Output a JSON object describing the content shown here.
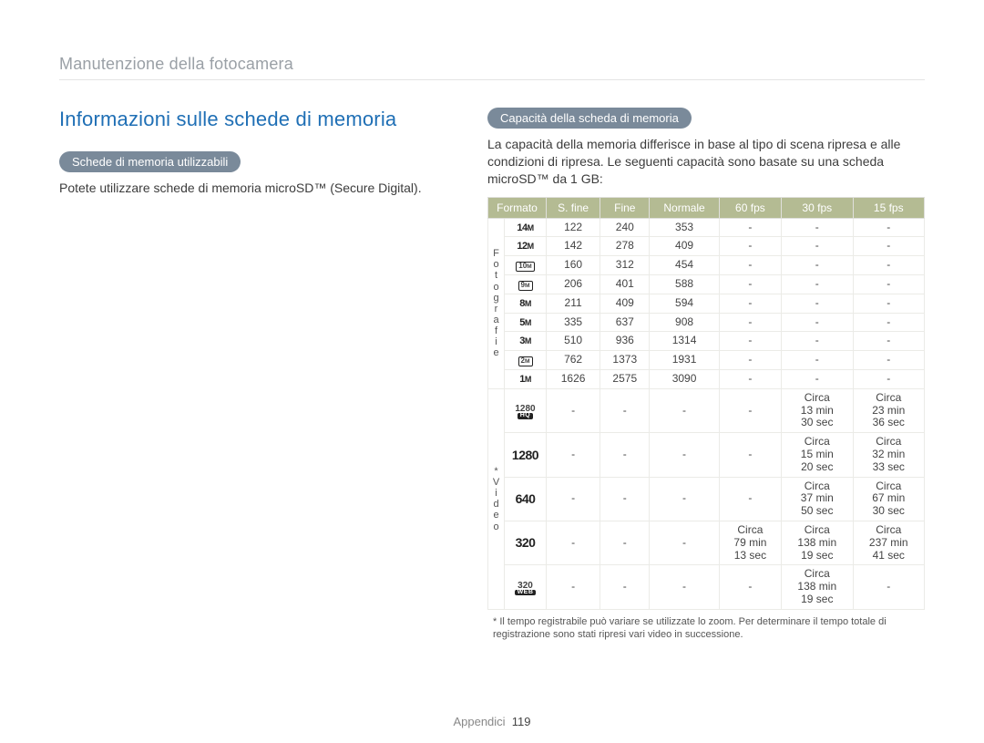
{
  "breadcrumb": "Manutenzione della fotocamera",
  "section_title": "Informazioni sulle schede di memoria",
  "left": {
    "pill": "Schede di memoria utilizzabili",
    "text": "Potete utilizzare schede di memoria microSD™ (Secure Digital)."
  },
  "right": {
    "pill": "Capacità della scheda di memoria",
    "text": "La capacità della memoria differisce in base al tipo di scena ripresa e alle condizioni di ripresa. Le seguenti capacità sono basate su una scheda microSD™ da 1 GB:"
  },
  "table": {
    "headers": [
      "Formato",
      "S. fine",
      "Fine",
      "Normale",
      "60 fps",
      "30 fps",
      "15 fps"
    ],
    "groups": [
      {
        "label": "F o t o g r a f i e",
        "rows": [
          {
            "fmt_label": "14M",
            "fmt_type": "bold",
            "cells": [
              "122",
              "240",
              "353",
              "-",
              "-",
              "-"
            ]
          },
          {
            "fmt_label": "12M",
            "fmt_type": "bold",
            "cells": [
              "142",
              "278",
              "409",
              "-",
              "-",
              "-"
            ]
          },
          {
            "fmt_label": "10M",
            "fmt_type": "box",
            "cells": [
              "160",
              "312",
              "454",
              "-",
              "-",
              "-"
            ]
          },
          {
            "fmt_label": "9M",
            "fmt_type": "box",
            "cells": [
              "206",
              "401",
              "588",
              "-",
              "-",
              "-"
            ]
          },
          {
            "fmt_label": "8M",
            "fmt_type": "bold",
            "cells": [
              "211",
              "409",
              "594",
              "-",
              "-",
              "-"
            ]
          },
          {
            "fmt_label": "5M",
            "fmt_type": "bold",
            "cells": [
              "335",
              "637",
              "908",
              "-",
              "-",
              "-"
            ]
          },
          {
            "fmt_label": "3M",
            "fmt_type": "bold",
            "cells": [
              "510",
              "936",
              "1314",
              "-",
              "-",
              "-"
            ]
          },
          {
            "fmt_label": "2M",
            "fmt_type": "box",
            "cells": [
              "762",
              "1373",
              "1931",
              "-",
              "-",
              "-"
            ]
          },
          {
            "fmt_label": "1M",
            "fmt_type": "bold",
            "cells": [
              "1626",
              "2575",
              "3090",
              "-",
              "-",
              "-"
            ]
          }
        ]
      },
      {
        "label": "* V i d e o",
        "rows": [
          {
            "fmt_label": "1280",
            "fmt_sub": "HQ",
            "fmt_type": "stack",
            "cells": [
              "-",
              "-",
              "-",
              "-",
              "Circa\n13 min\n30 sec",
              "Circa\n23 min\n36 sec"
            ]
          },
          {
            "fmt_label": "1280",
            "fmt_type": "bold-lg",
            "cells": [
              "-",
              "-",
              "-",
              "-",
              "Circa\n15 min\n20 sec",
              "Circa\n32 min\n33 sec"
            ]
          },
          {
            "fmt_label": "640",
            "fmt_type": "bold-lg",
            "cells": [
              "-",
              "-",
              "-",
              "-",
              "Circa\n37 min\n50 sec",
              "Circa\n67 min\n30 sec"
            ]
          },
          {
            "fmt_label": "320",
            "fmt_type": "bold-lg",
            "cells": [
              "-",
              "-",
              "-",
              "Circa\n79 min\n13 sec",
              "Circa\n138 min\n19 sec",
              "Circa\n237 min\n41 sec"
            ]
          },
          {
            "fmt_label": "320",
            "fmt_sub": "WEB",
            "fmt_type": "stack",
            "cells": [
              "-",
              "-",
              "-",
              "-",
              "Circa\n138 min\n19 sec",
              "-"
            ]
          }
        ]
      }
    ]
  },
  "footnote": "* Il tempo registrabile può variare se utilizzate lo zoom. Per determinare il tempo totale di registrazione sono stati ripresi vari video in successione.",
  "footer": {
    "section": "Appendici",
    "page": "119"
  }
}
